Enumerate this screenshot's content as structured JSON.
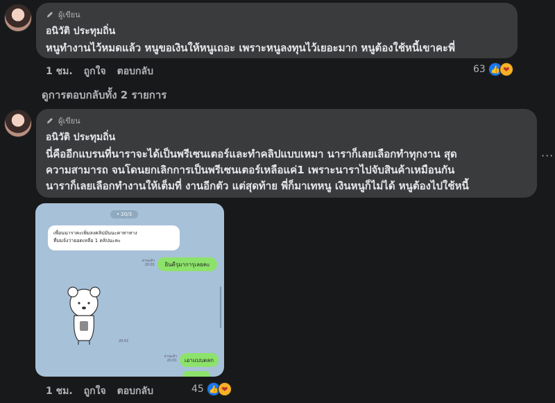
{
  "comments": [
    {
      "badge": "ผู้เขียน",
      "author": "อนิวัติ ประทุมถิ่น",
      "text_lines": [
        "หนูทำงานไว้หมดแล้ว หนูขอเงินให้หนูเถอะ เพราะหนูลงทุนไว้เยอะมาก หนูต้องใช้หนี้เขาคะพี่"
      ],
      "time": "1 ชม.",
      "like": "ถูกใจ",
      "reply": "ตอบกลับ",
      "reaction_count": "63"
    },
    {
      "badge": "ผู้เขียน",
      "author": "อนิวัติ ประทุมถิ่น",
      "text_lines": [
        "นี่คืออีกแบรนที่นาราจะได้เป็นพรีเซนเตอร์และทำคลิปแบบเหมา นาราก็เลยเลือกทำทุกงาน สุด",
        "ความสามารถ จนโดนยกเลิกการเป็นพรีเซนเตอร์เหลือแค่1 เพราะนาราไปจับสินค้าเหมือนกัน",
        "นาราก็เลยเลือกทำงานให้เต็มที่ งานอีกตัว แต่สุดท้าย พี่ก็มาเทหนู เงินหนูก็ไม่ได้ หนูต้องไปใช้หนี้"
      ],
      "time": "1 ชม.",
      "like": "ถูกใจ",
      "reply": "ตอบกลับ",
      "reaction_count": "45"
    }
  ],
  "view_replies": "ดูการตอบกลับทั้ง 2 รายการ",
  "more_options": "···",
  "chat_image": {
    "date_pill": "• 20/3",
    "left_msg_line1": "เพื่อนนาราคะเพิ่มลงคลิปมันนะคาทาทาง",
    "left_msg_line2": "ที่มมจ้งว่ายอดเหลือ 1 คลิปนะคะ",
    "right_msg1": "ยินดีรุมาการุเลยคะ",
    "right_msg2": "เอาแบบตลก",
    "time_small1": "อ่านแล้ว 20:01",
    "time_small2": "20:01",
    "time_small3": "อ่านแล้ว 20:01"
  },
  "icons": {
    "like": "like-icon",
    "care": "care-icon",
    "pen": "pen-icon"
  },
  "colors": {
    "background": "#18191a",
    "bubble": "#3a3b3c",
    "like_blue": "#1877f2",
    "chat_bg": "#a7c1d8",
    "chat_green": "#8de26b"
  }
}
